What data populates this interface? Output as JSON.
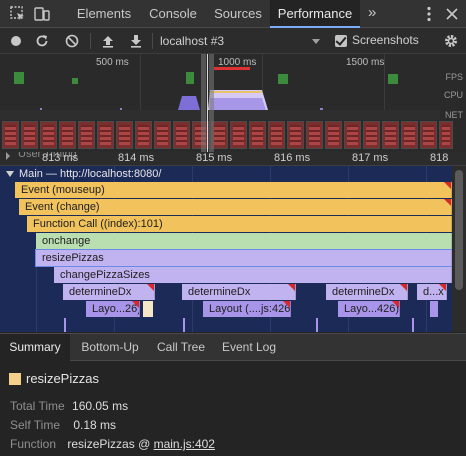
{
  "tabs": {
    "items": [
      "Elements",
      "Console",
      "Sources",
      "Performance"
    ],
    "active": "Performance",
    "more": "»"
  },
  "toolbar": {
    "profile": "localhost #3",
    "screenshots_label": "Screenshots",
    "screenshots_checked": true
  },
  "overview": {
    "time_labels": [
      "500 ms",
      "1000 ms",
      "1500 ms"
    ],
    "side_labels": [
      "FPS",
      "CPU",
      "NET"
    ]
  },
  "timeline": {
    "user_timing": "User Timing",
    "ticks": [
      "813 ms",
      "814 ms",
      "815 ms",
      "816 ms",
      "817 ms",
      "818 ms"
    ]
  },
  "flame": {
    "main_label": "Main — http://localhost:8080/",
    "bars": {
      "mouseup": "Event (mouseup)",
      "change": "Event (change)",
      "function_call": "Function Call ((index):101)",
      "onchange": "onchange",
      "resize": "resizePizzas",
      "change_sizes": "changePizzaSizes",
      "dx1": "determineDx",
      "dx2": "determineDx",
      "dx3": "determineDx",
      "dx4": "d...x",
      "layout1": "Layo...26)",
      "layout2": "Layout (....js:426)",
      "layout3": "Layo...426)"
    }
  },
  "bottom_tabs": {
    "items": [
      "Summary",
      "Bottom-Up",
      "Call Tree",
      "Event Log"
    ],
    "active": "Summary"
  },
  "summary": {
    "title": "resizePizzas",
    "swatch_color": "#f5d08a",
    "total_time_label": "Total Time",
    "total_time_value": "160.05 ms",
    "self_time_label": "Self Time",
    "self_time_value": "0.18 ms",
    "function_label": "Function",
    "function_name": "resizePizzas @",
    "function_link": "main.js:402"
  }
}
